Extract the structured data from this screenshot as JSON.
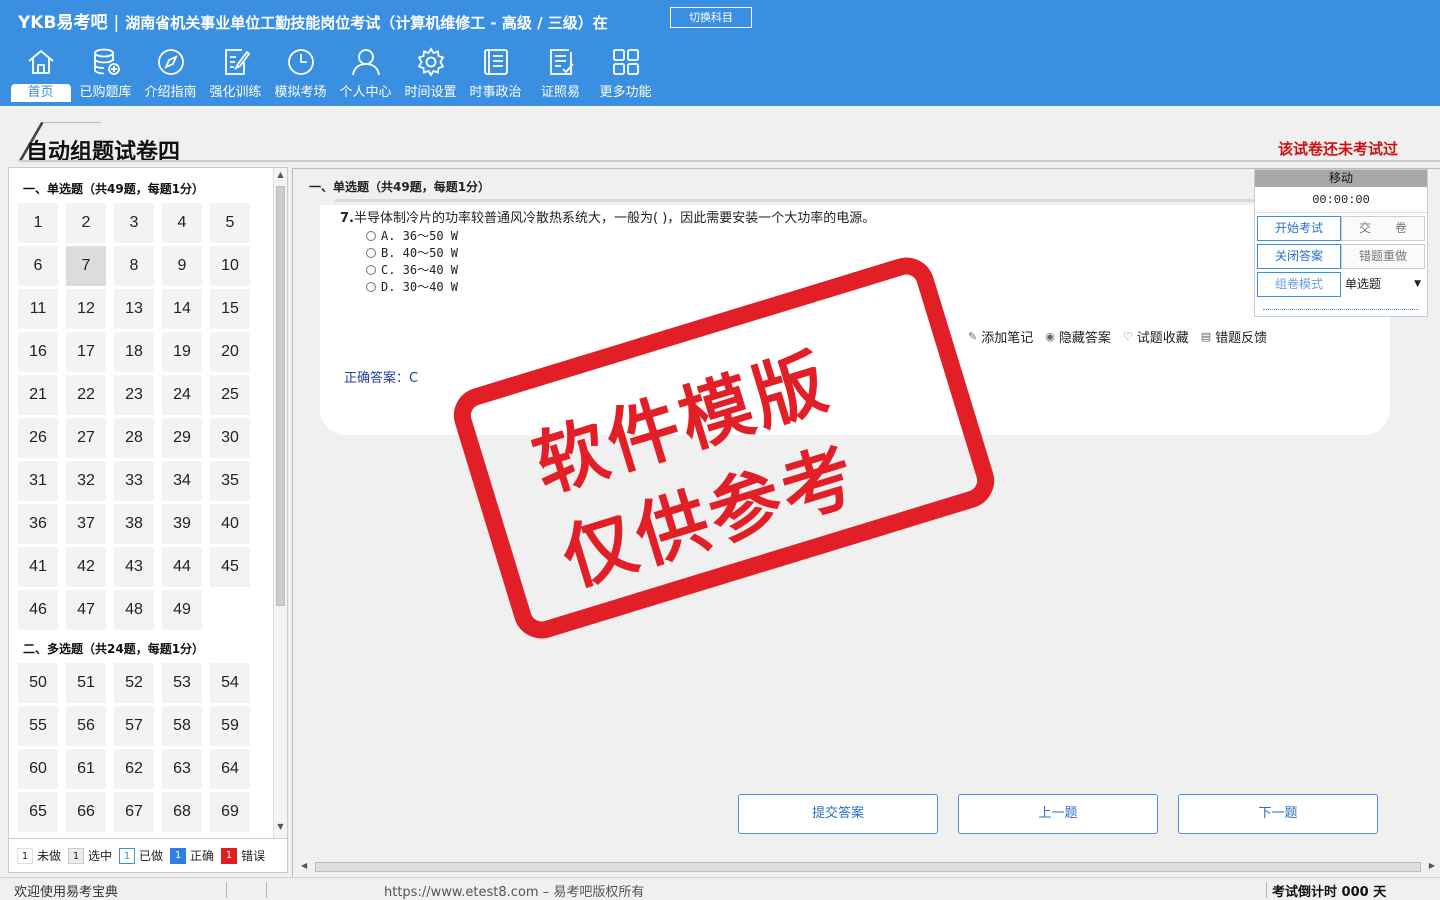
{
  "header": {
    "logo": "YKB易考吧",
    "title": "湖南省机关事业单位工勤技能岗位考试（计算机维修工 - 高级 / 三级）在",
    "switch_label": "切换科目"
  },
  "nav": [
    {
      "label": "首页",
      "icon": "home-icon"
    },
    {
      "label": "已购题库",
      "icon": "database-icon"
    },
    {
      "label": "介绍指南",
      "icon": "compass-icon"
    },
    {
      "label": "强化训练",
      "icon": "edit-icon"
    },
    {
      "label": "模拟考场",
      "icon": "clock-icon"
    },
    {
      "label": "个人中心",
      "icon": "user-icon"
    },
    {
      "label": "时间设置",
      "icon": "gear-icon"
    },
    {
      "label": "时事政治",
      "icon": "newspaper-icon"
    },
    {
      "label": "证照易",
      "icon": "checklist-icon"
    },
    {
      "label": "更多功能",
      "icon": "grid-icon"
    }
  ],
  "paper": {
    "title": "自动组题试卷四",
    "status": "该试卷还未考试过"
  },
  "sections": [
    {
      "title": "一、单选题（共49题，每题1分）",
      "from": 1,
      "to": 49
    },
    {
      "title": "二、多选题（共24题，每题1分）",
      "from": 50,
      "to": 69
    }
  ],
  "current_question": 7,
  "legend": [
    {
      "box": "1",
      "label": "未做",
      "kind": "undone"
    },
    {
      "box": "1",
      "label": "选中",
      "kind": "sel"
    },
    {
      "box": "1",
      "label": "已做",
      "kind": "done"
    },
    {
      "box": "1",
      "label": "正确",
      "kind": "right"
    },
    {
      "box": "1",
      "label": "错误",
      "kind": "wrong"
    }
  ],
  "main": {
    "section_title": "一、单选题（共49题，每题1分）",
    "question": {
      "number": "7.",
      "stem": "半导体制冷片的功率较普通风冷散热系统大，一般为( )，因此需要安装一个大功率的电源。",
      "options": [
        "A. 36～50 W",
        "B. 40～50 W",
        "C. 36～40 W",
        "D. 30～40 W"
      ],
      "answer_label": "正确答案：",
      "answer": "C"
    },
    "tools": [
      {
        "label": "添加笔记",
        "icon": "pencil-icon",
        "glyph": "✎"
      },
      {
        "label": "隐藏答案",
        "icon": "eye-icon",
        "glyph": "◉"
      },
      {
        "label": "试题收藏",
        "icon": "heart-icon",
        "glyph": "♡"
      },
      {
        "label": "错题反馈",
        "icon": "feedback-icon",
        "glyph": "▤"
      }
    ]
  },
  "controls": {
    "move": "移动",
    "timer": "00:00:00",
    "start_exam": "开始考试",
    "submit_paper": "交　　卷",
    "close_answer": "关闭答案",
    "redo_wrong": "错题重做",
    "compose_mode": "组卷模式",
    "type_select": "单选题"
  },
  "buttons": {
    "submit_answer": "提交答案",
    "prev": "上一题",
    "next": "下一题"
  },
  "watermark": {
    "line1": "软件模版",
    "line2": "仅供参考"
  },
  "status": {
    "welcome": "欢迎使用易考宝典",
    "copyright": "https://www.etest8.com – 易考吧版权所有",
    "countdown": "考试倒计时 000 天"
  },
  "colors": {
    "header_blue": "#3a8fe0",
    "stamp_red": "#e21f27",
    "status_red": "#d01010"
  }
}
